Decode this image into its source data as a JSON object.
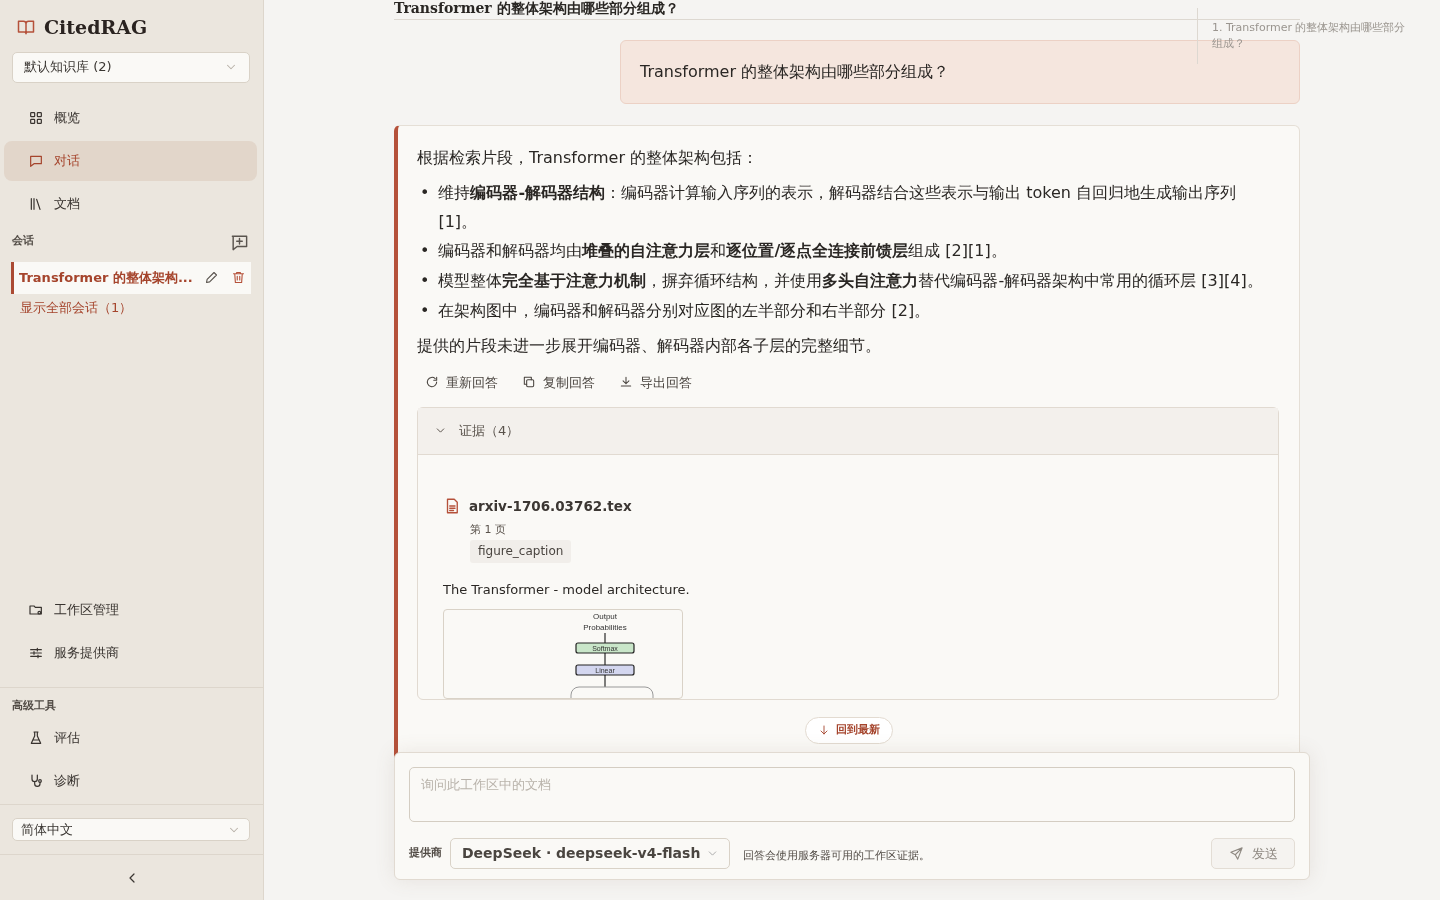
{
  "sidebar": {
    "brand": "CitedRAG",
    "knowledge_base": "默认知识库 (2)",
    "nav": [
      {
        "label": "概览",
        "selected": false
      },
      {
        "label": "对话",
        "selected": true
      },
      {
        "label": "文档",
        "selected": false
      }
    ],
    "sessions_label": "会话",
    "sessions": [
      {
        "title": "Transformer 的整体架构...",
        "selected": true
      }
    ],
    "show_all": "显示全部会话（1）",
    "bottom_nav": [
      {
        "label": "工作区管理"
      },
      {
        "label": "服务提供商"
      }
    ],
    "advanced_label": "高级工具",
    "advanced_nav": [
      {
        "label": "评估"
      },
      {
        "label": "诊断"
      }
    ],
    "language": "简体中文"
  },
  "conversation": {
    "heading": "Transformer 的整体架构由哪些部分组成？",
    "question": "Transformer 的整体架构由哪些部分组成？",
    "answer": {
      "bullet_marker": "•",
      "intro": "根据检索片段，Transformer 的整体架构包括：",
      "bullets": [
        "维持**编码器-解码器结构**：编码器计算输入序列的表示，解码器结合这些表示与输出 token 自回归地生成输出序列 [1]。",
        "编码器和解码器均由**堆叠的自注意力层**和**逐位置/逐点全连接前馈层**组成 [2][1]。",
        "模型整体**完全基于注意力机制**，摒弃循环结构，并使用**多头自注意力**替代编码器-解码器架构中常用的循环层 [3][4]。",
        "在架构图中，编码器和解码器分别对应图的左半部分和右半部分 [2]。"
      ],
      "closing": "提供的片段未进一步展开编码器、解码器内部各子层的完整细节。",
      "actions": [
        "重新回答",
        "复制回答",
        "导出回答"
      ]
    },
    "evidence": {
      "title": "证据（4）",
      "expanded": true,
      "items": [
        {
          "file": "arxiv-1706.03762.tex",
          "page": "第 1 页",
          "tag": "figure_caption",
          "text": "The Transformer - model architecture.",
          "figure": {
            "top": "Output",
            "top2": "Probabilities",
            "boxes": [
              {
                "label": "Softmax",
                "color": "#c9e6c9"
              },
              {
                "label": "Linear",
                "color": "#d3d6ef"
              }
            ]
          }
        }
      ]
    },
    "jump_latest": "回到最新"
  },
  "outline": [
    {
      "text": "1. Transformer 的整体架构由哪些部分组成？"
    }
  ],
  "composer": {
    "placeholder": "询问此工作区中的文档",
    "provider_label": "提供商",
    "provider": "DeepSeek · deepseek-v4-flash",
    "note": "回答会使用服务器可用的工作区证据。",
    "send": "发送",
    "send_disabled": true
  }
}
